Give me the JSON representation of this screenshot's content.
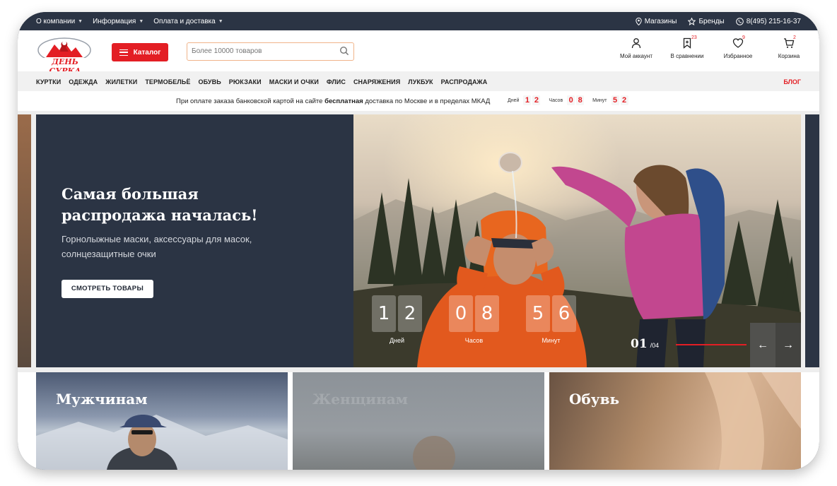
{
  "topbar": {
    "links": [
      "О компании",
      "Информация",
      "Оплата и доставка"
    ],
    "stores": "Магазины",
    "brands": "Бренды",
    "phone": "8(495) 215-16-37"
  },
  "header": {
    "logo_text": "ДЕНЬ СУРКА",
    "catalog_label": "Каталог",
    "search_placeholder": "Более 10000 товаров",
    "account_label": "Мой аккаунт",
    "compare_label": "В сравнении",
    "compare_count": "23",
    "favorites_label": "Избранное",
    "favorites_count": "9",
    "cart_label": "Корзина",
    "cart_count": "2"
  },
  "nav": {
    "items": [
      "КУРТКИ",
      "ОДЕЖДА",
      "ЖИЛЕТКИ",
      "ТЕРМОБЕЛЬЁ",
      "ОБУВЬ",
      "РЮКЗАКИ",
      "МАСКИ И ОЧКИ",
      "ФЛИС",
      "СНАРЯЖЕНИЯ",
      "ЛУКБУК",
      "РАСПРОДАЖА"
    ],
    "blog": "БЛОГ"
  },
  "promo": {
    "text_before": "При оплате заказа банковской картой на сайте ",
    "text_bold": "бесплатная",
    "text_after": " доставка по Москве и в пределах МКАД",
    "days_label": "Дней",
    "days": [
      "1",
      "2"
    ],
    "hours_label": "Часов",
    "hours": [
      "0",
      "8"
    ],
    "minutes_label": "Минут",
    "minutes": [
      "5",
      "2"
    ]
  },
  "hero": {
    "title": "Самая большая распродажа началась!",
    "subtitle": "Горнолыжные маски, аксессуары для масок, солнцезащитные очки",
    "button": "СМОТРЕТЬ ТОВАРЫ",
    "timer": {
      "days": [
        "1",
        "2"
      ],
      "hours": [
        "0",
        "8"
      ],
      "minutes": [
        "5",
        "6"
      ],
      "days_label": "Дней",
      "hours_label": "Часов",
      "minutes_label": "Минут"
    },
    "slide_current": "01",
    "slide_total": "/04",
    "prev_icon": "arrow-left-icon",
    "next_icon": "arrow-right-icon"
  },
  "categories": [
    {
      "title": "Мужчинам"
    },
    {
      "title": "Женщинам"
    },
    {
      "title": "Обувь"
    }
  ],
  "colors": {
    "brand_red": "#e31e24",
    "dark": "#2b3444"
  }
}
